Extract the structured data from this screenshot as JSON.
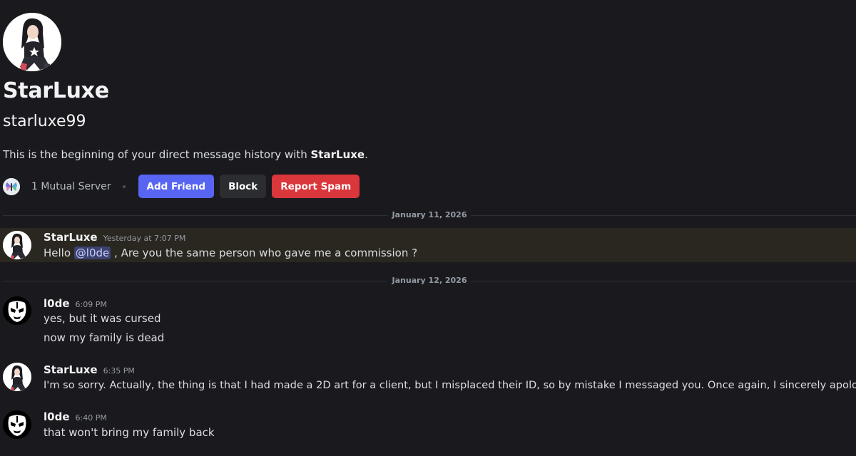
{
  "profile": {
    "display_name": "StarLuxe",
    "username": "starluxe99",
    "intro_prefix": "This is the beginning of your direct message history with ",
    "intro_name": "StarLuxe",
    "intro_suffix": ".",
    "mutual_servers": "1 Mutual Server"
  },
  "actions": {
    "add_friend": "Add Friend",
    "block": "Block",
    "report_spam": "Report Spam"
  },
  "dividers": [
    "January 11, 2026",
    "January 12, 2026"
  ],
  "messages": [
    {
      "author": "StarLuxe",
      "time": "Yesterday at 7:07 PM",
      "prefix": "Hello ",
      "mention": "@l0de",
      "suffix": " , Are you the same person who gave me a commission ?"
    },
    {
      "author": "l0de",
      "time": "6:09 PM",
      "lines": [
        "yes, but it was cursed",
        "now my family is dead"
      ]
    },
    {
      "author": "StarLuxe",
      "time": "6:35 PM",
      "lines": [
        "I'm so sorry. Actually, the thing is that I had made a 2D art for a client, but I misplaced their ID, so by mistake I messaged you. Once again, I sincerely apologize"
      ]
    },
    {
      "author": "l0de",
      "time": "6:40 PM",
      "lines": [
        "that won't bring my family back"
      ]
    }
  ],
  "colors": {
    "background": "#1a1a1e",
    "add_friend": "#5865f2",
    "block": "#2b2d31",
    "report_spam": "#da373c",
    "highlight": "#2a2720",
    "mention_bg": "#3c4270"
  },
  "icons": {
    "profile_avatar": "anime-character-avatar",
    "server_icon": "butterfly-server-icon",
    "lode_avatar": "mask-avatar"
  }
}
